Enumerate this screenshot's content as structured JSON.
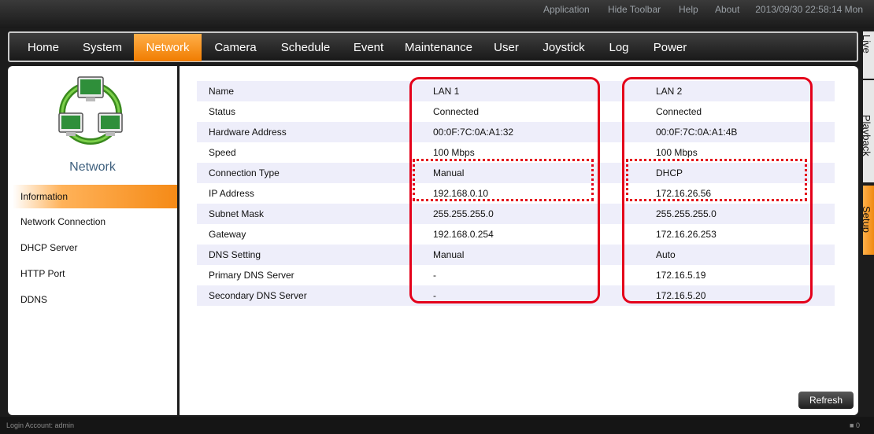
{
  "topbar": {
    "links": [
      "Application",
      "Hide Toolbar",
      "Help",
      "About"
    ],
    "clock": "2013/09/30 22:58:14 Mon"
  },
  "nav": {
    "items": [
      "Home",
      "System",
      "Network",
      "Camera",
      "Schedule",
      "Event",
      "Maintenance",
      "User",
      "Joystick",
      "Log",
      "Power"
    ],
    "active": "Network"
  },
  "side_tabs": [
    "Live",
    "Playback",
    "Setup"
  ],
  "left": {
    "section_title": "Network",
    "items": [
      "Information",
      "Network Connection",
      "DHCP Server",
      "HTTP Port",
      "DDNS"
    ],
    "active": "Information"
  },
  "table": {
    "rows": [
      {
        "label": "Name",
        "lan1": "LAN 1",
        "lan2": "LAN 2"
      },
      {
        "label": "Status",
        "lan1": "Connected",
        "lan2": "Connected"
      },
      {
        "label": "Hardware Address",
        "lan1": "00:0F:7C:0A:A1:32",
        "lan2": "00:0F:7C:0A:A1:4B"
      },
      {
        "label": "Speed",
        "lan1": "100 Mbps",
        "lan2": "100 Mbps"
      },
      {
        "label": "Connection Type",
        "lan1": "Manual",
        "lan2": "DHCP"
      },
      {
        "label": "IP Address",
        "lan1": "192.168.0.10",
        "lan2": "172.16.26.56"
      },
      {
        "label": "Subnet Mask",
        "lan1": "255.255.255.0",
        "lan2": "255.255.255.0"
      },
      {
        "label": "Gateway",
        "lan1": "192.168.0.254",
        "lan2": "172.16.26.253"
      },
      {
        "label": "DNS Setting",
        "lan1": "Manual",
        "lan2": "Auto"
      },
      {
        "label": "Primary DNS Server",
        "lan1": "-",
        "lan2": "172.16.5.19"
      },
      {
        "label": "Secondary DNS Server",
        "lan1": "-",
        "lan2": "172.16.5.20"
      }
    ]
  },
  "buttons": {
    "refresh": "Refresh"
  },
  "status": {
    "login": "Login Account: admin",
    "right": "0"
  },
  "colors": {
    "accent": "#f58a16",
    "highlight_red": "#e4001a",
    "section_title": "#3d5f7d",
    "row_stripe": "#eeeefa"
  }
}
